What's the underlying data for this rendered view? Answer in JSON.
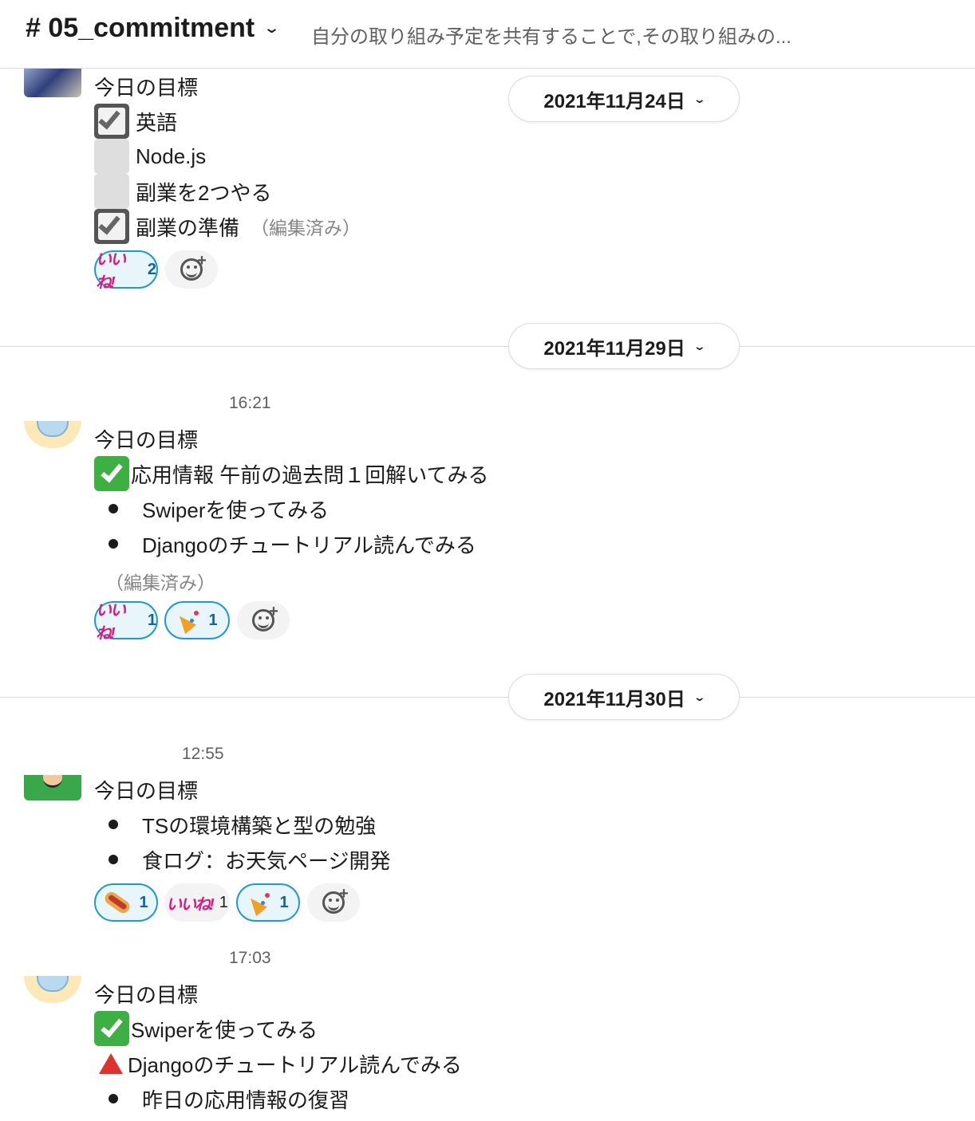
{
  "header": {
    "channel": "# 05_commitment",
    "topic": "自分の取り組み予定を共有することで,その取り組みの..."
  },
  "dates": [
    "2021年11月24日",
    "2021年11月29日",
    "2021年11月30日"
  ],
  "messages": [
    {
      "time": "",
      "title": "今日の目標",
      "items": [
        {
          "marker": "checkbox-checked",
          "text": "英語"
        },
        {
          "marker": "checkbox-empty",
          "text": "Node.js"
        },
        {
          "marker": "checkbox-empty",
          "text": "副業を2つやる"
        },
        {
          "marker": "checkbox-checked",
          "text": "副業の準備",
          "edited": "（編集済み）"
        }
      ],
      "reactions": [
        {
          "emoji": "いいね!",
          "count": "2",
          "mine": true
        }
      ]
    },
    {
      "time": "16:21",
      "title": "今日の目標",
      "items": [
        {
          "marker": "green-check",
          "text": "応用情報 午前の過去問１回解いてみる"
        },
        {
          "marker": "bullet",
          "text": "Swiperを使ってみる"
        },
        {
          "marker": "bullet",
          "text": "Djangoのチュートリアル読んでみる"
        }
      ],
      "edited": "（編集済み）",
      "reactions": [
        {
          "emoji": "いいね!",
          "count": "1",
          "mine": true
        },
        {
          "emoji": "party-popper",
          "count": "1",
          "mine": true
        }
      ]
    },
    {
      "time": "12:55",
      "title": "今日の目標",
      "items": [
        {
          "marker": "bullet",
          "text": "TSの環境構築と型の勉強"
        },
        {
          "marker": "bullet",
          "text": "食ログ：お天気ページ開発"
        }
      ],
      "reactions": [
        {
          "emoji": "hotdog",
          "count": "1",
          "mine": true
        },
        {
          "emoji": "いいね!",
          "count": "1",
          "mine": false
        },
        {
          "emoji": "party-popper",
          "count": "1",
          "mine": true
        }
      ]
    },
    {
      "time": "17:03",
      "title": "今日の目標",
      "items": [
        {
          "marker": "green-check",
          "text": "Swiperを使ってみる"
        },
        {
          "marker": "red-triangle",
          "text": "Djangoのチュートリアル読んでみる"
        },
        {
          "marker": "bullet",
          "text": "昨日の応用情報の復習"
        }
      ]
    }
  ],
  "colors": {
    "accent": "#1d9bd1",
    "divider": "#dddddd",
    "green_check": "#3cb043",
    "red_triangle": "#e0322c",
    "iine": "#e0177e"
  }
}
